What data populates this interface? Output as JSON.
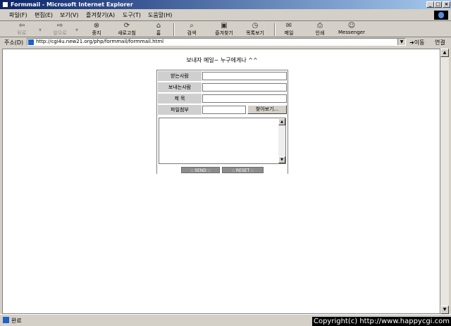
{
  "window": {
    "title": "Formmail - Microsoft Internet Explorer"
  },
  "menu": [
    "파일(F)",
    "편집(E)",
    "보기(V)",
    "즐겨찾기(A)",
    "도구(T)",
    "도움말(H)"
  ],
  "toolbar": {
    "back": "뒤로",
    "forward": "앞으로",
    "stop": "중지",
    "refresh": "새로고침",
    "home": "홈",
    "search": "검색",
    "favorites": "즐겨찾기",
    "history": "목록보기",
    "mail": "메일",
    "print": "인쇄",
    "messenger": "Messenger"
  },
  "address": {
    "label": "주소(D)",
    "url": "http://cgi4u.new21.org/php/formmail/formmail.html",
    "go": "이동",
    "links": "연결"
  },
  "page": {
    "heading": "보내자 메일~ 누구에게나 ^^"
  },
  "form": {
    "to_label": "받는사람",
    "from_label": "보내는사람",
    "subject_label": "제 목",
    "attach_label": "파일첨부",
    "browse": "찾아보기...",
    "send": ":: SEND ::",
    "reset": ":: RESET ::"
  },
  "status": {
    "text": "완료",
    "overlay": "Copyright(c) http://www.happycgi.com"
  }
}
